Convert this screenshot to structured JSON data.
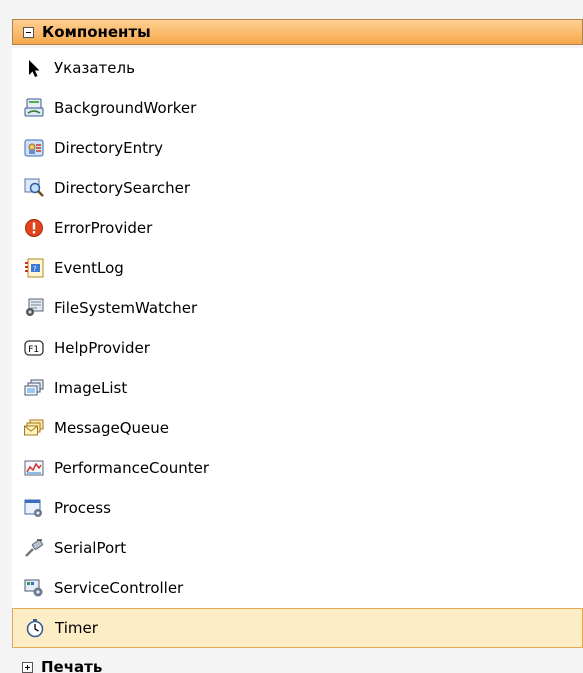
{
  "groups": [
    {
      "title": "Компоненты",
      "items": [
        {
          "label": "Указатель",
          "icon": "pointer-icon"
        },
        {
          "label": "BackgroundWorker",
          "icon": "background-worker-icon"
        },
        {
          "label": "DirectoryEntry",
          "icon": "directory-entry-icon"
        },
        {
          "label": "DirectorySearcher",
          "icon": "directory-searcher-icon"
        },
        {
          "label": "ErrorProvider",
          "icon": "error-provider-icon"
        },
        {
          "label": "EventLog",
          "icon": "event-log-icon"
        },
        {
          "label": "FileSystemWatcher",
          "icon": "file-system-watcher-icon"
        },
        {
          "label": "HelpProvider",
          "icon": "help-provider-icon"
        },
        {
          "label": "ImageList",
          "icon": "image-list-icon"
        },
        {
          "label": "MessageQueue",
          "icon": "message-queue-icon"
        },
        {
          "label": "PerformanceCounter",
          "icon": "performance-counter-icon"
        },
        {
          "label": "Process",
          "icon": "process-icon"
        },
        {
          "label": "SerialPort",
          "icon": "serial-port-icon"
        },
        {
          "label": "ServiceController",
          "icon": "service-controller-icon"
        },
        {
          "label": "Timer",
          "icon": "timer-icon"
        }
      ]
    },
    {
      "title": "Печать"
    }
  ],
  "selected_item": "Timer",
  "colors": {
    "header_gradient_top": "#ffd092",
    "header_gradient_bottom": "#f6a84a",
    "selection_fill": "#fdedc4",
    "selection_border": "#e3a957"
  }
}
